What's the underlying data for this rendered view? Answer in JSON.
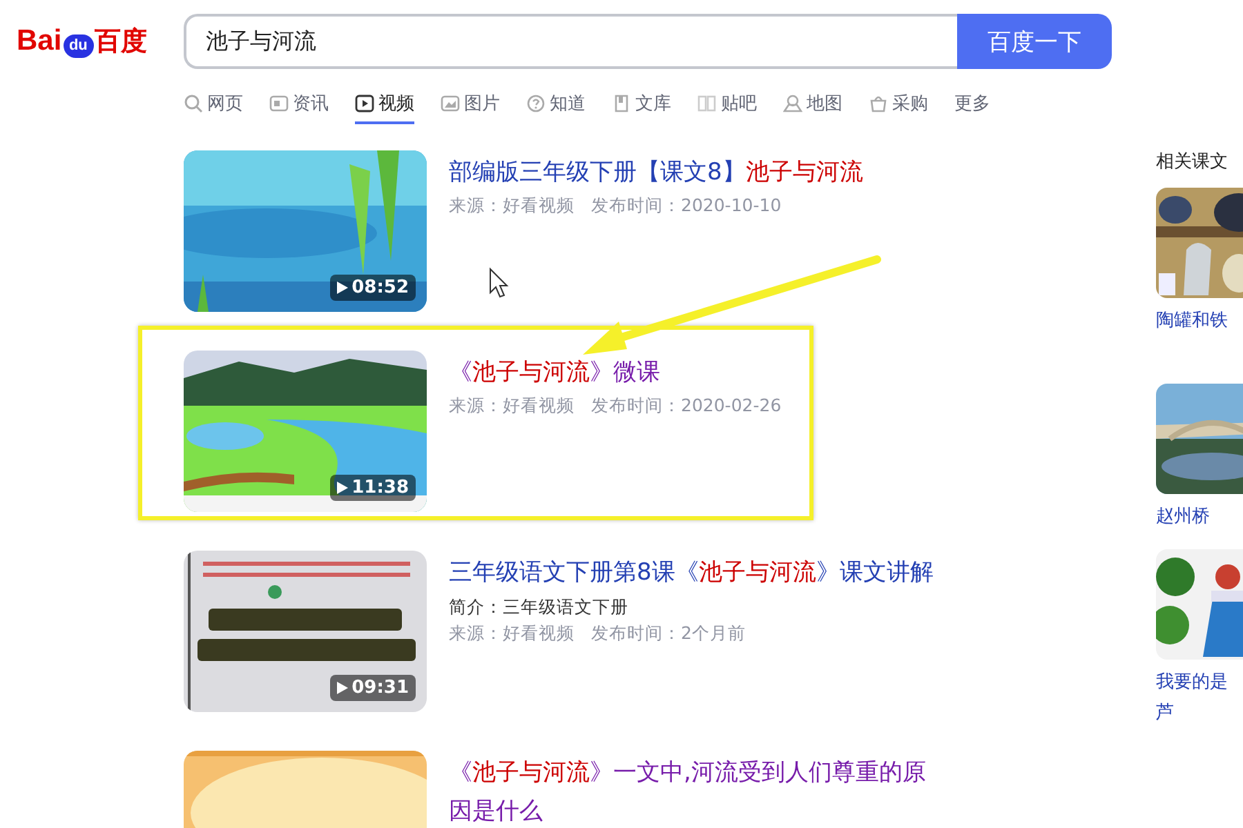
{
  "logo": {
    "text_left": "Bai",
    "text_paw": "du",
    "text_right": "百度"
  },
  "search": {
    "value": "池子与河流",
    "button": "百度一下"
  },
  "tabs": [
    {
      "label": "网页",
      "selected": false
    },
    {
      "label": "资讯",
      "selected": false
    },
    {
      "label": "视频",
      "selected": true
    },
    {
      "label": "图片",
      "selected": false
    },
    {
      "label": "知道",
      "selected": false
    },
    {
      "label": "文库",
      "selected": false
    },
    {
      "label": "贴吧",
      "selected": false
    },
    {
      "label": "地图",
      "selected": false
    },
    {
      "label": "采购",
      "selected": false
    },
    {
      "label": "更多",
      "selected": false
    }
  ],
  "results": [
    {
      "title": [
        {
          "text": "部编版三年级下册【课文8】",
          "highlight": false
        },
        {
          "text": "池子与河流",
          "highlight": true
        }
      ],
      "visited": false,
      "highlighted": false,
      "duration": "08:52",
      "meta": [
        "来源：好看视频",
        "发布时间：2020-10-10"
      ]
    },
    {
      "title": [
        {
          "text": "《",
          "highlight": false
        },
        {
          "text": "池子与河流",
          "highlight": true
        },
        {
          "text": "》微课",
          "highlight": false
        }
      ],
      "visited": true,
      "highlighted": true,
      "duration": "11:38",
      "meta": [
        "来源：好看视频",
        "发布时间：2020-02-26"
      ]
    },
    {
      "title": [
        {
          "text": "三年级语文下册第8课《",
          "highlight": false
        },
        {
          "text": "池子与河流",
          "highlight": true
        },
        {
          "text": "》课文讲解",
          "highlight": false
        }
      ],
      "visited": false,
      "highlighted": false,
      "duration": "09:31",
      "summary": "简介：三年级语文下册",
      "meta": [
        "来源：好看视频",
        "发布时间：2个月前"
      ]
    },
    {
      "title": [
        {
          "text": "《",
          "highlight": false
        },
        {
          "text": "池子与河流",
          "highlight": true
        },
        {
          "text": "》一文中,河流受到人们尊重的原因是什么",
          "highlight": false
        }
      ],
      "visited": true,
      "highlighted": false
    }
  ],
  "related": {
    "heading": "相关课文",
    "items": [
      {
        "lines": [
          "陶罐和铁"
        ]
      },
      {
        "lines": [
          "赵州桥"
        ]
      },
      {
        "lines": [
          "我要的是",
          "芦"
        ]
      }
    ]
  }
}
